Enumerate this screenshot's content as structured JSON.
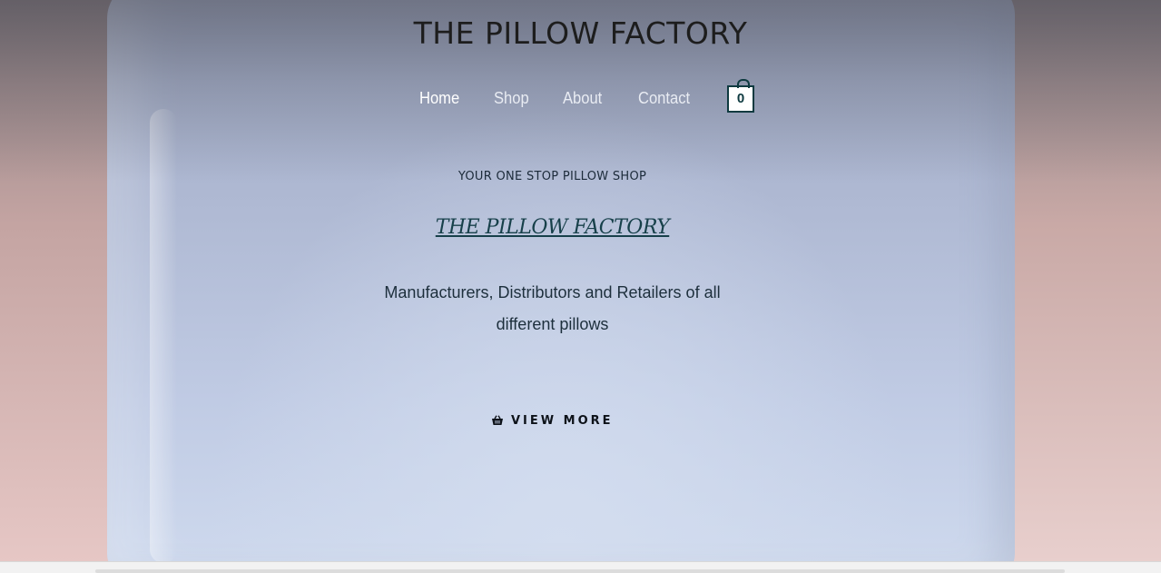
{
  "header": {
    "site_title": "THE PILLOW FACTORY"
  },
  "nav": {
    "items": [
      {
        "label": "Home",
        "active": true
      },
      {
        "label": "Shop",
        "active": false
      },
      {
        "label": "About",
        "active": false
      },
      {
        "label": "Contact",
        "active": false
      }
    ],
    "cart_count": "0",
    "cart_icon": "shopping-bag-icon"
  },
  "hero": {
    "tagline": "YOUR ONE STOP PILLOW SHOP",
    "script_title": "THE PILLOW FACTORY",
    "description": "Manufacturers, Distributors and Retailers of all different pillows",
    "cta_label": "VIEW MORE",
    "cta_icon": "basket-icon"
  },
  "colors": {
    "accent": "#0e3a40",
    "title_text": "#1d1d1d",
    "nav_text": "#e9ecf3"
  }
}
